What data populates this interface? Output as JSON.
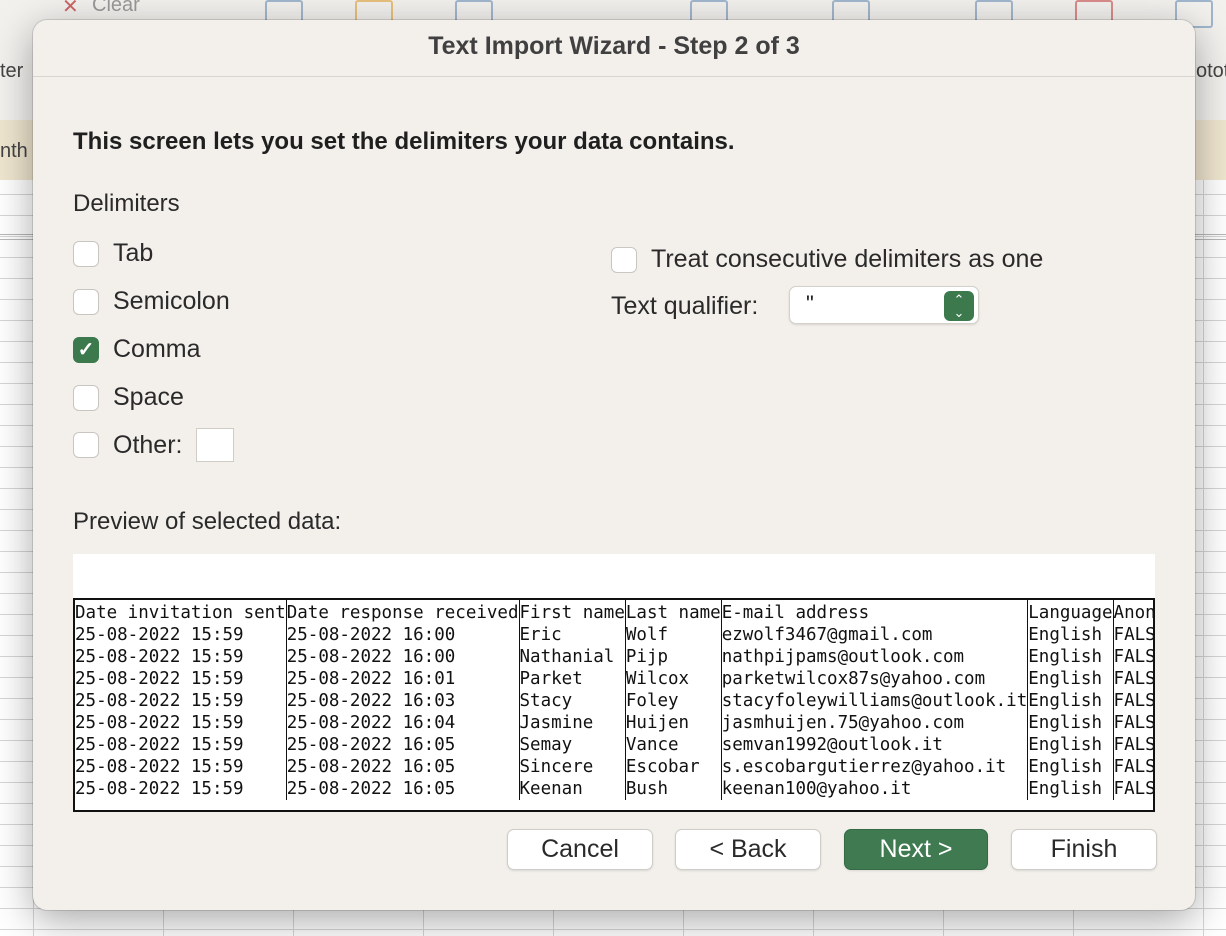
{
  "background": {
    "ribbon_clear_label": "Clear",
    "left_fragment_1": "ter",
    "left_fragment_2": "nth",
    "right_fragment": "otot"
  },
  "dialog": {
    "title": "Text Import Wizard - Step 2 of 3",
    "heading": "This screen lets you set the delimiters your data contains.",
    "delimiters_label": "Delimiters",
    "delimiters": [
      {
        "label": "Tab",
        "checked": false
      },
      {
        "label": "Semicolon",
        "checked": false
      },
      {
        "label": "Comma",
        "checked": true
      },
      {
        "label": "Space",
        "checked": false
      },
      {
        "label": "Other:",
        "checked": false
      }
    ],
    "other_value": "",
    "consecutive_label": "Treat consecutive delimiters as one",
    "consecutive_checked": false,
    "text_qualifier_label": "Text qualifier:",
    "text_qualifier_value": "\"",
    "preview_label": "Preview of selected data:",
    "preview": {
      "headers": [
        "Date invitation sent",
        "Date response received",
        "First name",
        "Last name",
        "E-mail address",
        "Language",
        "Anon"
      ],
      "rows": [
        [
          "25-08-2022 15:59",
          "25-08-2022 16:00",
          "Eric",
          "Wolf",
          "ezwolf3467@gmail.com",
          "English",
          "FALS"
        ],
        [
          "25-08-2022 15:59",
          "25-08-2022 16:00",
          "Nathanial",
          "Pijp",
          "nathpijpams@outlook.com",
          "English",
          "FALS"
        ],
        [
          "25-08-2022 15:59",
          "25-08-2022 16:01",
          "Parket",
          "Wilcox",
          "parketwilcox87s@yahoo.com",
          "English",
          "FALS"
        ],
        [
          "25-08-2022 15:59",
          "25-08-2022 16:03",
          "Stacy",
          "Foley",
          "stacyfoleywilliams@outlook.it",
          "English",
          "FALS"
        ],
        [
          "25-08-2022 15:59",
          "25-08-2022 16:04",
          "Jasmine",
          "Huijen",
          "jasmhuijen.75@yahoo.com",
          "English",
          "FALS"
        ],
        [
          "25-08-2022 15:59",
          "25-08-2022 16:05",
          "Semay",
          "Vance",
          "semvan1992@outlook.it",
          "English",
          "FALS"
        ],
        [
          "25-08-2022 15:59",
          "25-08-2022 16:05",
          "Sincere",
          "Escobar",
          "s.escobargutierrez@yahoo.it",
          "English",
          "FALS"
        ],
        [
          "25-08-2022 15:59",
          "25-08-2022 16:05",
          "Keenan",
          "Bush",
          "keenan100@yahoo.it",
          "English",
          "FALS"
        ]
      ]
    },
    "buttons": {
      "cancel": "Cancel",
      "back": "< Back",
      "next": "Next >",
      "finish": "Finish"
    },
    "colors": {
      "accent": "#3f7a51",
      "dialog_bg": "#f3f0ec"
    }
  }
}
